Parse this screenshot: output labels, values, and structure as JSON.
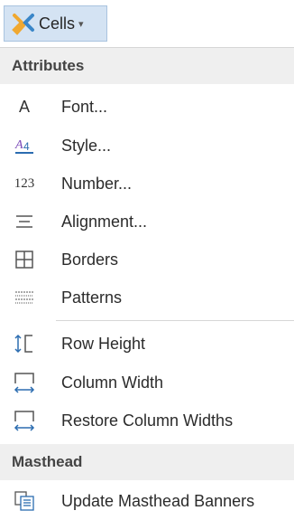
{
  "ribbon": {
    "label": "Cells",
    "icon": "cells-icon"
  },
  "menu": {
    "section_attributes": "Attributes",
    "section_masthead": "Masthead",
    "items": [
      {
        "label": "Font...",
        "icon": "font-icon",
        "icon_text": "A"
      },
      {
        "label": "Style...",
        "icon": "style-icon",
        "icon_text": "A"
      },
      {
        "label": "Number...",
        "icon": "number-icon",
        "icon_text": "123"
      },
      {
        "label": "Alignment...",
        "icon": "alignment-icon"
      },
      {
        "label": "Borders",
        "icon": "borders-icon"
      },
      {
        "label": "Patterns",
        "icon": "patterns-icon"
      },
      {
        "label": "Row Height",
        "icon": "row-height-icon"
      },
      {
        "label": "Column Width",
        "icon": "column-width-icon"
      },
      {
        "label": "Restore Column Widths",
        "icon": "restore-column-widths-icon"
      },
      {
        "label": "Update Masthead Banners",
        "icon": "masthead-banners-icon"
      }
    ]
  },
  "colors": {
    "accent": "#d4e3f3",
    "header_bg": "#efefef",
    "icon_blue": "#2b6cb0"
  }
}
